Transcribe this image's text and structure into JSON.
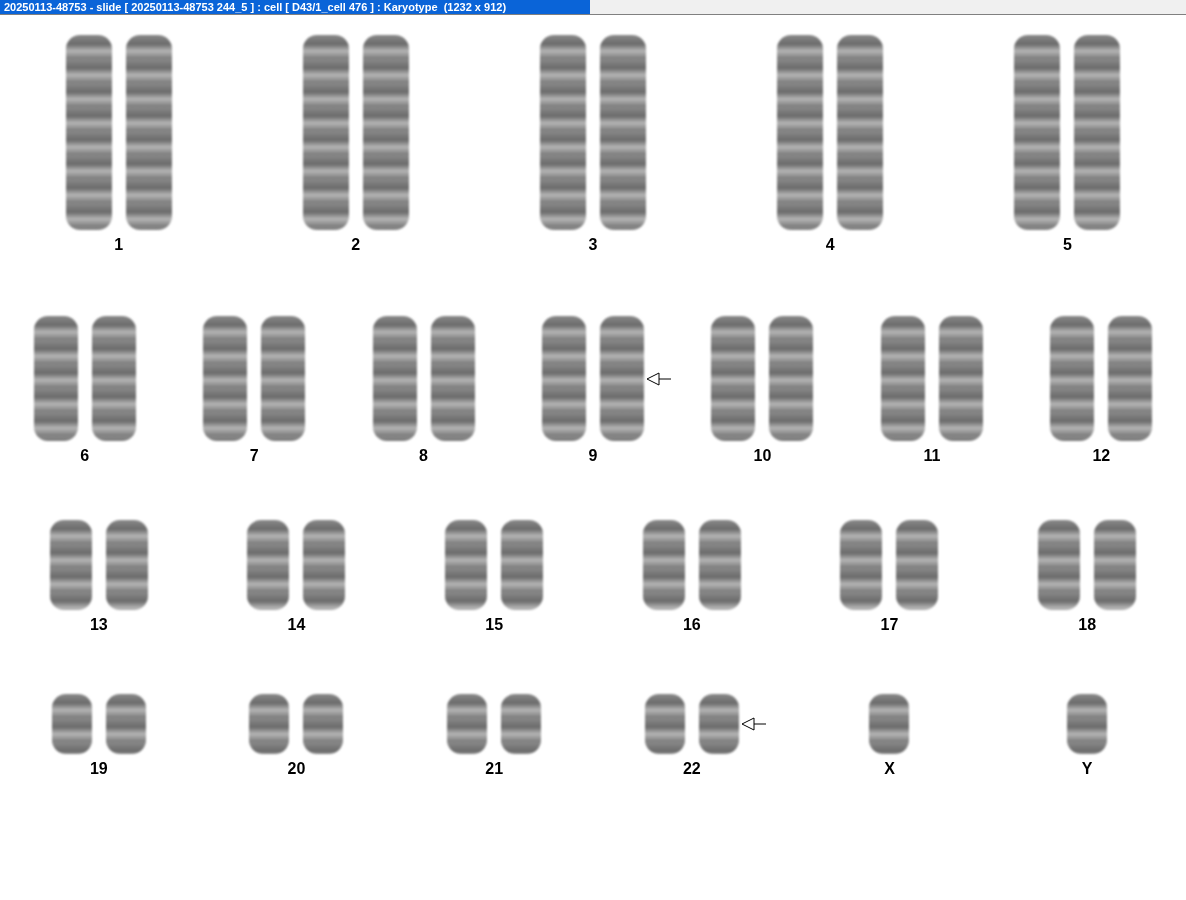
{
  "window": {
    "title": "20250113-48753 - slide [ 20250113-48753 244_5 ] : cell [ D43/1_cell 476 ] : Karyotype  (1232 x 912)"
  },
  "karyotype": {
    "rows": [
      {
        "items": [
          {
            "label": "1",
            "kind": "pair",
            "marked": false
          },
          {
            "label": "2",
            "kind": "pair",
            "marked": false
          },
          {
            "label": "3",
            "kind": "pair",
            "marked": false
          },
          {
            "label": "4",
            "kind": "pair",
            "marked": false
          },
          {
            "label": "5",
            "kind": "pair",
            "marked": false
          }
        ]
      },
      {
        "items": [
          {
            "label": "6",
            "kind": "pair",
            "marked": false
          },
          {
            "label": "7",
            "kind": "pair",
            "marked": false
          },
          {
            "label": "8",
            "kind": "pair",
            "marked": false
          },
          {
            "label": "9",
            "kind": "pair",
            "marked": true
          },
          {
            "label": "10",
            "kind": "pair",
            "marked": false
          },
          {
            "label": "11",
            "kind": "pair",
            "marked": false
          },
          {
            "label": "12",
            "kind": "pair",
            "marked": false
          }
        ]
      },
      {
        "items": [
          {
            "label": "13",
            "kind": "pair",
            "marked": false
          },
          {
            "label": "14",
            "kind": "pair",
            "marked": false
          },
          {
            "label": "15",
            "kind": "pair",
            "marked": false
          },
          {
            "label": "16",
            "kind": "pair",
            "marked": false
          },
          {
            "label": "17",
            "kind": "pair",
            "marked": false
          },
          {
            "label": "18",
            "kind": "pair",
            "marked": false
          }
        ]
      },
      {
        "items": [
          {
            "label": "19",
            "kind": "pair",
            "marked": false
          },
          {
            "label": "20",
            "kind": "pair",
            "marked": false
          },
          {
            "label": "21",
            "kind": "pair",
            "marked": false
          },
          {
            "label": "22",
            "kind": "pair",
            "marked": true
          },
          {
            "label": "X",
            "kind": "single",
            "marked": false
          },
          {
            "label": "Y",
            "kind": "single",
            "marked": false
          }
        ]
      }
    ]
  }
}
